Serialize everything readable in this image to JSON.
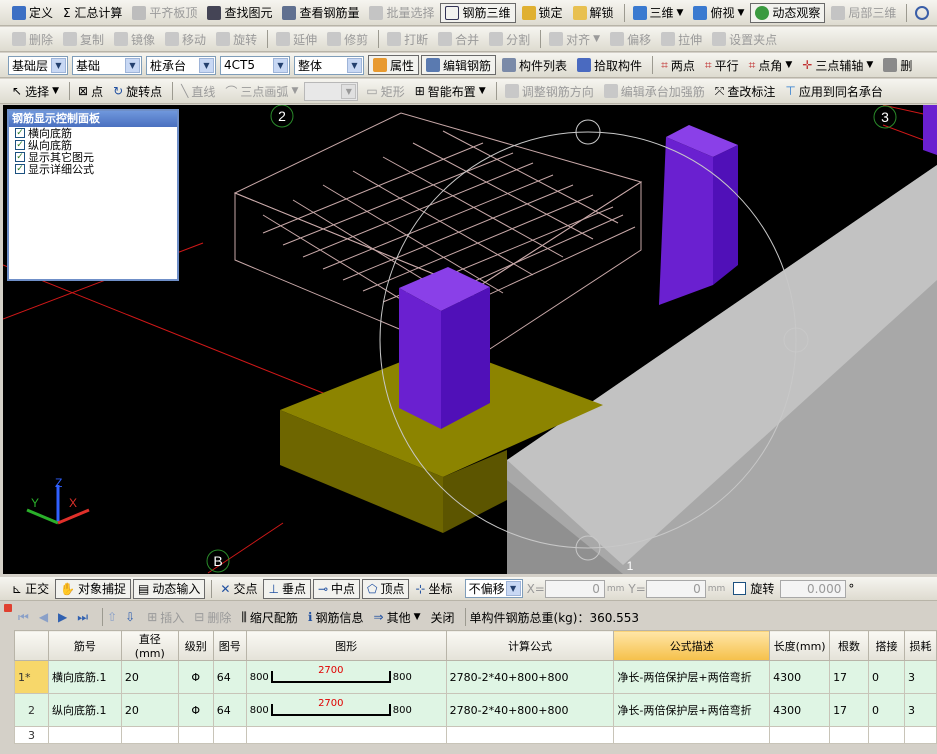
{
  "menu_bar": {
    "items": [
      {
        "label": "定义",
        "icon": "define-icon",
        "disabled": false
      },
      {
        "label": "Σ 汇总计算",
        "icon": "sum-icon",
        "disabled": false
      },
      {
        "label": "平齐板顶",
        "icon": "flush-top-icon",
        "disabled": true
      },
      {
        "label": "查找图元",
        "icon": "binoculars-icon",
        "disabled": false
      },
      {
        "label": "查看钢筋量",
        "icon": "view-rebar-icon",
        "disabled": false
      },
      {
        "label": "批量选择",
        "icon": "batch-select-icon",
        "disabled": true
      },
      {
        "label": "钢筋三维",
        "icon": "rebar-3d-icon",
        "disabled": false,
        "pressed": true
      },
      {
        "label": "锁定",
        "icon": "lock-icon",
        "disabled": false
      },
      {
        "label": "解锁",
        "icon": "unlock-icon",
        "disabled": false
      },
      {
        "label": "三维",
        "icon": "cube-icon",
        "disabled": false,
        "dropdown": true
      },
      {
        "label": "俯视",
        "icon": "top-view-icon",
        "disabled": false,
        "dropdown": true
      },
      {
        "label": "动态观察",
        "icon": "orbit-icon",
        "disabled": false,
        "pressed": true
      },
      {
        "label": "局部三维",
        "icon": "local-3d-icon",
        "disabled": true
      }
    ]
  },
  "edit_bar": {
    "items": [
      {
        "label": "删除",
        "icon": "delete-icon"
      },
      {
        "label": "复制",
        "icon": "copy-icon"
      },
      {
        "label": "镜像",
        "icon": "mirror-icon"
      },
      {
        "label": "移动",
        "icon": "move-icon"
      },
      {
        "label": "旋转",
        "icon": "rotate-icon"
      },
      {
        "label": "延伸",
        "icon": "extend-icon"
      },
      {
        "label": "修剪",
        "icon": "trim-icon"
      },
      {
        "label": "打断",
        "icon": "break-icon"
      },
      {
        "label": "合并",
        "icon": "merge-icon"
      },
      {
        "label": "分割",
        "icon": "split-icon"
      },
      {
        "label": "对齐",
        "icon": "align-icon",
        "dropdown": true
      },
      {
        "label": "偏移",
        "icon": "offset-icon"
      },
      {
        "label": "拉伸",
        "icon": "stretch-icon"
      },
      {
        "label": "设置夹点",
        "icon": "grip-icon"
      }
    ]
  },
  "selector_bar": {
    "combos": [
      {
        "value": "基础层"
      },
      {
        "value": "基础"
      },
      {
        "value": "桩承台"
      },
      {
        "value": "4CT5"
      },
      {
        "value": "整体"
      }
    ],
    "buttons": [
      {
        "label": "属性",
        "icon": "properties-icon",
        "pressed": true
      },
      {
        "label": "编辑钢筋",
        "icon": "edit-rebar-icon",
        "pressed": true
      },
      {
        "label": "构件列表",
        "icon": "list-icon"
      },
      {
        "label": "拾取构件",
        "icon": "pick-icon"
      },
      {
        "label": "两点",
        "icon": "two-point-axis-icon"
      },
      {
        "label": "平行",
        "icon": "parallel-icon"
      },
      {
        "label": "点角",
        "icon": "point-angle-icon",
        "dropdown": true
      },
      {
        "label": "三点辅轴",
        "icon": "three-point-axis-icon",
        "dropdown": true
      },
      {
        "label": "删",
        "icon": "delete-axis-icon"
      }
    ]
  },
  "draw_bar": {
    "items": [
      {
        "label": "选择",
        "icon": "cursor-icon",
        "dropdown": true,
        "disabled": false
      },
      {
        "label": "点",
        "icon": "point-icon",
        "disabled": false
      },
      {
        "label": "旋转点",
        "icon": "rotate-point-icon",
        "disabled": false
      },
      {
        "label": "直线",
        "icon": "line-icon",
        "disabled": true
      },
      {
        "label": "三点画弧",
        "icon": "arc-icon",
        "disabled": true,
        "dropdown": true
      },
      {
        "label": "矩形",
        "icon": "rectangle-icon",
        "disabled": true
      },
      {
        "label": "智能布置",
        "icon": "smart-layout-icon",
        "disabled": false,
        "dropdown": true
      },
      {
        "label": "调整钢筋方向",
        "icon": "adjust-direction-icon",
        "disabled": true
      },
      {
        "label": "编辑承台加强筋",
        "icon": "edit-reinforce-icon",
        "disabled": true
      },
      {
        "label": "查改标注",
        "icon": "annotation-icon",
        "disabled": false
      },
      {
        "label": "应用到同名承台",
        "icon": "apply-same-icon",
        "disabled": false
      }
    ]
  },
  "viewport": {
    "axis_labels": [
      "2",
      "3",
      "B",
      "1"
    ],
    "axis_colors": {
      "x": "#e0302a",
      "y": "#2ab02a",
      "z": "#3060ff"
    },
    "triad_labels": {
      "x": "X",
      "y": "Y",
      "z": "Z"
    }
  },
  "control_panel": {
    "title": "钢筋显示控制面板",
    "items": [
      {
        "label": "横向底筋",
        "checked": true
      },
      {
        "label": "纵向底筋",
        "checked": true
      },
      {
        "label": "显示其它图元",
        "checked": true
      },
      {
        "label": "显示详细公式",
        "checked": true
      }
    ]
  },
  "snap_bar": {
    "items": [
      {
        "label": "正交",
        "icon": "ortho-icon",
        "pressed": false
      },
      {
        "label": "对象捕捉",
        "icon": "snap-icon",
        "pressed": true
      },
      {
        "label": "动态输入",
        "icon": "dynamic-input-icon",
        "pressed": true
      },
      {
        "label": "交点",
        "icon": "intersection-icon",
        "pressed": false
      },
      {
        "label": "垂点",
        "icon": "perpendicular-icon",
        "pressed": true
      },
      {
        "label": "中点",
        "icon": "midpoint-icon",
        "pressed": true
      },
      {
        "label": "顶点",
        "icon": "vertex-icon",
        "pressed": true
      },
      {
        "label": "坐标",
        "icon": "coordinate-icon",
        "pressed": false
      }
    ],
    "offset_mode": "不偏移",
    "x_label": "X=",
    "x_value": "0",
    "y_label": "Y=",
    "y_value": "0",
    "unit": "mm",
    "rotate_label": "旋转",
    "rotate_value": "0.000",
    "degree": "°"
  },
  "rebar_toolbar": {
    "items": [
      {
        "label": "插入",
        "icon": "insert-icon",
        "disabled": true
      },
      {
        "label": "删除",
        "icon": "delete-row-icon",
        "disabled": true
      },
      {
        "label": "缩尺配筋",
        "icon": "scale-rebar-icon",
        "disabled": false
      },
      {
        "label": "钢筋信息",
        "icon": "rebar-info-icon",
        "disabled": false
      },
      {
        "label": "其他",
        "icon": "other-icon",
        "disabled": false,
        "dropdown": true
      },
      {
        "label": "关闭",
        "icon": "",
        "disabled": false
      }
    ],
    "total_weight_label": "单构件钢筋总重(kg)：360.553"
  },
  "rebar_table": {
    "columns": [
      "筋号",
      "直径(mm)",
      "级别",
      "图号",
      "图形",
      "计算公式",
      "公式描述",
      "长度(mm)",
      "根数",
      "搭接",
      "损耗"
    ],
    "rows": [
      {
        "num": "1*",
        "name": "横向底筋.1",
        "diameter": "20",
        "grade": "Φ",
        "fig": "64",
        "shape_left": "800",
        "shape_mid": "2700",
        "shape_right": "800",
        "formula": "2780-2*40+800+800",
        "desc": "净长-两倍保护层+两倍弯折",
        "length": "4300",
        "count": "17",
        "lap": "0",
        "loss": "3"
      },
      {
        "num": "2",
        "name": "纵向底筋.1",
        "diameter": "20",
        "grade": "Φ",
        "fig": "64",
        "shape_left": "800",
        "shape_mid": "2700",
        "shape_right": "800",
        "formula": "2780-2*40+800+800",
        "desc": "净长-两倍保护层+两倍弯折",
        "length": "4300",
        "count": "17",
        "lap": "0",
        "loss": "3"
      },
      {
        "num": "3",
        "name": "",
        "diameter": "",
        "grade": "",
        "fig": "",
        "shape_left": "",
        "shape_mid": "",
        "shape_right": "",
        "formula": "",
        "desc": "",
        "length": "",
        "count": "",
        "lap": "",
        "loss": ""
      }
    ]
  }
}
